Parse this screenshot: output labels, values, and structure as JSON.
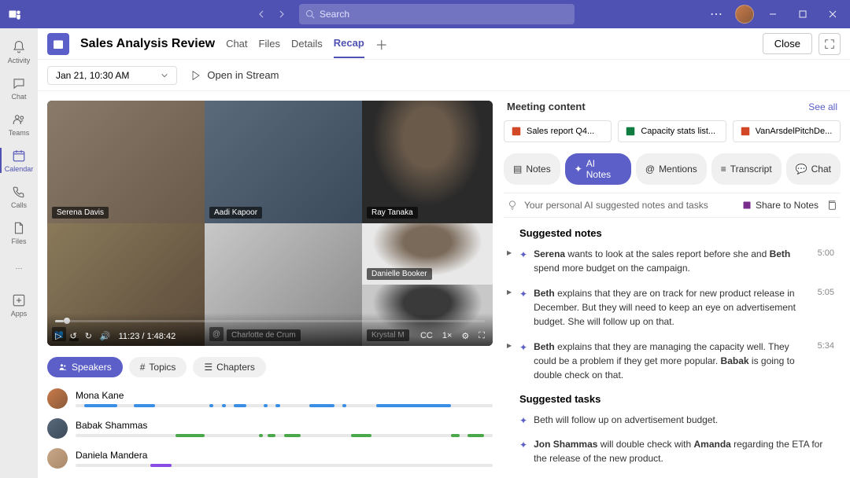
{
  "titlebar": {
    "search_placeholder": "Search"
  },
  "sidebar": {
    "items": [
      {
        "label": "Activity"
      },
      {
        "label": "Chat"
      },
      {
        "label": "Teams"
      },
      {
        "label": "Calendar"
      },
      {
        "label": "Calls"
      },
      {
        "label": "Files"
      },
      {
        "label": ""
      },
      {
        "label": "Apps"
      }
    ]
  },
  "header": {
    "meeting_title": "Sales Analysis Review",
    "tabs": [
      "Chat",
      "Files",
      "Details",
      "Recap"
    ],
    "active_tab": "Recap",
    "close_label": "Close"
  },
  "subheader": {
    "date_label": "Jan 21, 10:30 AM",
    "open_stream_label": "Open in Stream"
  },
  "video": {
    "participants": [
      "Serena Davis",
      "Aadi Kapoor",
      "Ray Tanaka",
      "",
      "Charlotte de Crum",
      "Danielle Booker",
      "Krystal M"
    ],
    "time_current": "11:23",
    "time_total": "1:48:42"
  },
  "filter_tabs": [
    "Speakers",
    "Topics",
    "Chapters"
  ],
  "speakers": [
    {
      "name": "Mona Kane",
      "color": "#3a8ee6",
      "avatar": "linear-gradient(135deg,#c97a4a,#8a5a3a)",
      "segs": [
        [
          2,
          8
        ],
        [
          14,
          5
        ],
        [
          32,
          1
        ],
        [
          35,
          1
        ],
        [
          38,
          3
        ],
        [
          45,
          1
        ],
        [
          48,
          1
        ],
        [
          56,
          6
        ],
        [
          64,
          1
        ],
        [
          72,
          18
        ]
      ]
    },
    {
      "name": "Babak Shammas",
      "color": "#4aa84a",
      "avatar": "linear-gradient(135deg,#5a6a7a,#3a4a5a)",
      "segs": [
        [
          24,
          7
        ],
        [
          44,
          1
        ],
        [
          46,
          2
        ],
        [
          50,
          4
        ],
        [
          66,
          5
        ],
        [
          90,
          2
        ],
        [
          94,
          4
        ]
      ]
    },
    {
      "name": "Daniela Mandera",
      "color": "#8a4ae6",
      "avatar": "linear-gradient(135deg,#c8a888,#a88868)",
      "segs": [
        [
          18,
          5
        ]
      ]
    }
  ],
  "meeting_content": {
    "title": "Meeting content",
    "see_all": "See all",
    "attachments": [
      {
        "name": "Sales report Q4...",
        "type": "ppt"
      },
      {
        "name": "Capacity stats list...",
        "type": "xls"
      },
      {
        "name": "VanArsdelPitchDe...",
        "type": "ppt"
      }
    ]
  },
  "recap_tabs": [
    "Notes",
    "AI Notes",
    "Mentions",
    "Transcript",
    "Chat"
  ],
  "recap_active": "AI Notes",
  "ai_header": {
    "subtitle": "Your personal AI suggested notes and tasks",
    "share_label": "Share to Notes"
  },
  "suggested_notes_title": "Suggested notes",
  "suggested_notes": [
    {
      "html": "<b>Serena</b> wants to look at the sales report before she and <b>Beth</b> spend more budget on the campaign.",
      "time": "5:00"
    },
    {
      "html": "<b>Beth</b> explains that they are on track for new product release in December. But they will need to keep an eye on advertisement budget. She will follow up on that.",
      "time": "5:05"
    },
    {
      "html": "<b>Beth</b> explains that they are managing the capacity well. They could be a problem if they get more popular. <b>Babak</b> is going to double check on that.",
      "time": "5:34"
    }
  ],
  "suggested_tasks_title": "Suggested tasks",
  "suggested_tasks": [
    {
      "html": "Beth will follow up on advertisement budget."
    },
    {
      "html": "<b>Jon Shammas</b> will double check with <b>Amanda</b> regarding the ETA for the release of the new product."
    }
  ]
}
